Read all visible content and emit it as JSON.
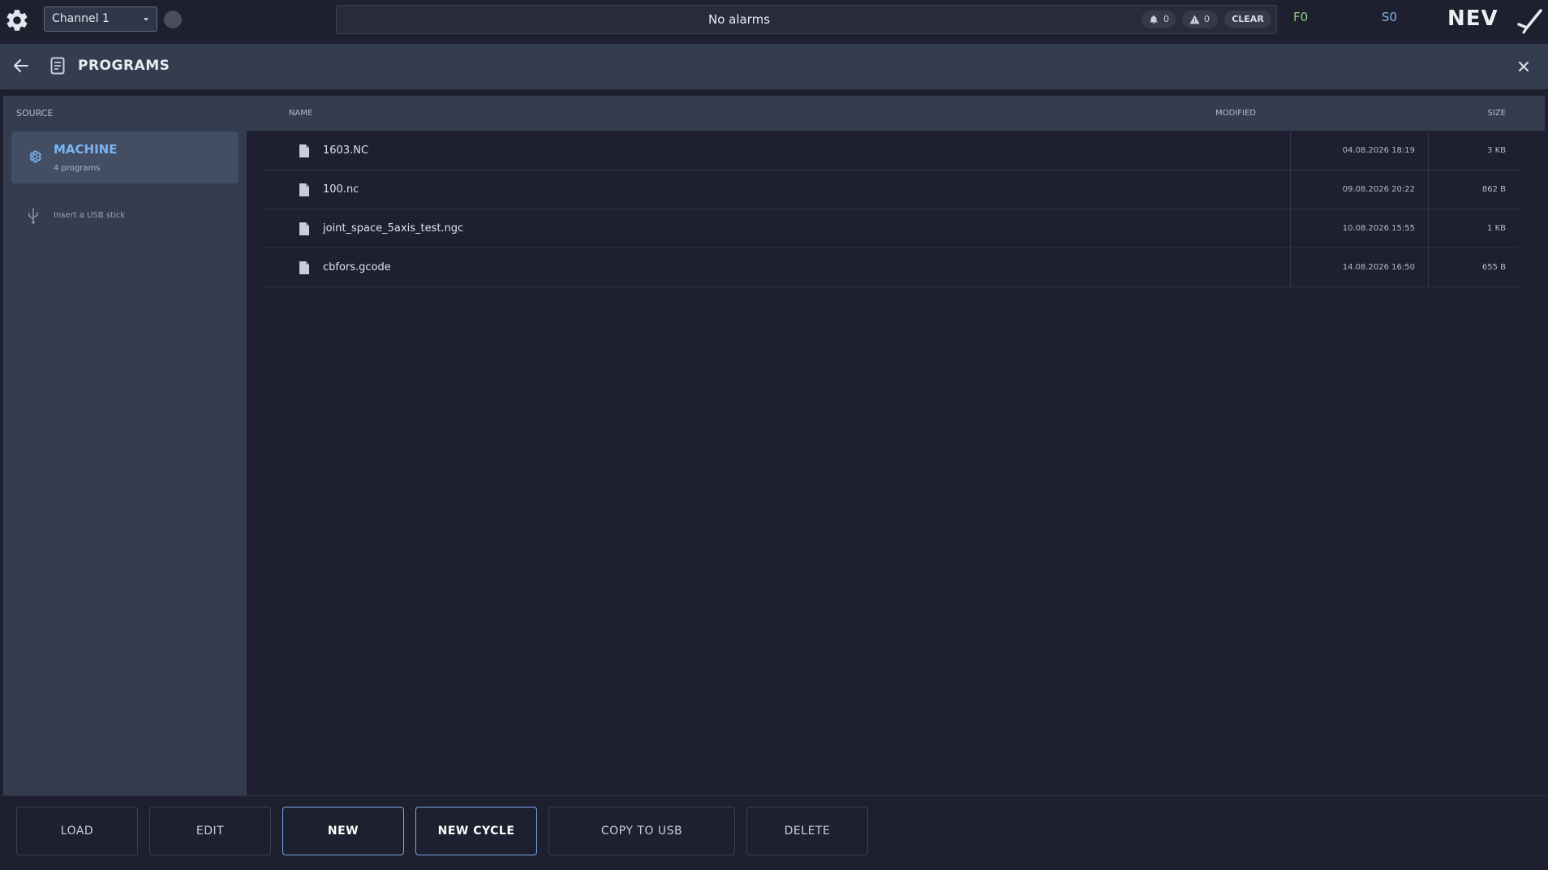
{
  "topbar": {
    "channel": "Channel 1",
    "alarm_text": "No alarms",
    "notifications_count": "0",
    "warnings_count": "0",
    "clear_label": "CLEAR",
    "feed": "F0",
    "spindle": "S0",
    "brand": "NEV"
  },
  "header": {
    "title": "PROGRAMS"
  },
  "sidebar": {
    "heading": "SOURCE",
    "machine": {
      "label": "MACHINE",
      "count": "4 programs"
    },
    "usb_hint": "Insert a USB stick"
  },
  "table": {
    "columns": {
      "name": "NAME",
      "modified": "MODIFIED",
      "size": "SIZE"
    },
    "rows": [
      {
        "name": "1603.NC",
        "modified": "04.08.2026 18:19",
        "size": "3 KB"
      },
      {
        "name": "100.nc",
        "modified": "09.08.2026 20:22",
        "size": "862 B"
      },
      {
        "name": "joint_space_5axis_test.ngc",
        "modified": "10.08.2026 15:55",
        "size": "1 KB"
      },
      {
        "name": "cbfors.gcode",
        "modified": "14.08.2026 16:50",
        "size": "655 B"
      }
    ]
  },
  "footer": {
    "load": "LOAD",
    "edit": "EDIT",
    "new": "NEW",
    "new_cycle": "NEW CYCLE",
    "copy_to_usb": "COPY TO USB",
    "delete": "DELETE"
  },
  "colors": {
    "accent": "#7ab4f0",
    "feed": "#8ccf7e",
    "spindle": "#7fb1e4",
    "primary_border": "#7ea6ea"
  }
}
